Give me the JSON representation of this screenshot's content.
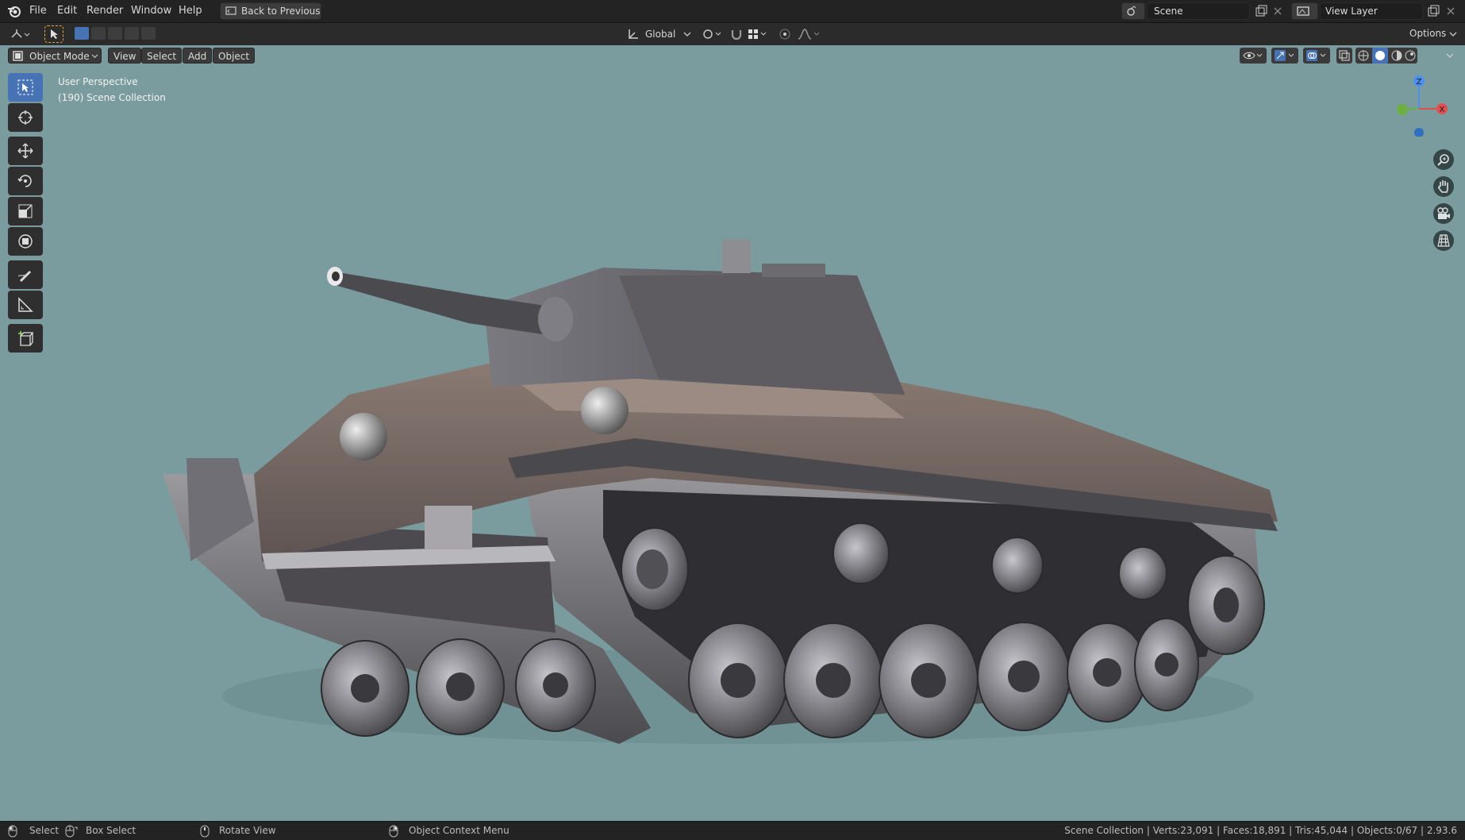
{
  "menu": {
    "items": [
      "File",
      "Edit",
      "Render",
      "Window",
      "Help"
    ],
    "back_label": "Back to Previous"
  },
  "top_right": {
    "scene_name": "Scene",
    "view_layer_name": "View Layer"
  },
  "tool_header": {
    "transform_orientation": "Global",
    "options_label": "Options"
  },
  "viewport_header": {
    "mode_label": "Object Mode",
    "view_label": "View",
    "select_label": "Select",
    "add_label": "Add",
    "object_label": "Object"
  },
  "viewport": {
    "perspective_text": "User Perspective",
    "collection_text": "(190) Scene Collection",
    "background_color": "#7b9c9e",
    "gizmo": {
      "z": "Z",
      "x": "X"
    }
  },
  "tools": [
    "select-box-icon",
    "cursor-icon",
    "move-icon",
    "rotate-icon",
    "scale-icon",
    "transform-icon",
    "annotate-icon",
    "measure-icon",
    "add-cube-icon"
  ],
  "status": {
    "select": "Select",
    "box_select": "Box Select",
    "rotate_view": "Rotate View",
    "context_menu": "Object Context Menu",
    "stats": "Scene Collection | Verts:23,091 | Faces:18,891 | Tris:45,044 | Objects:0/67 | 2.93.6"
  }
}
